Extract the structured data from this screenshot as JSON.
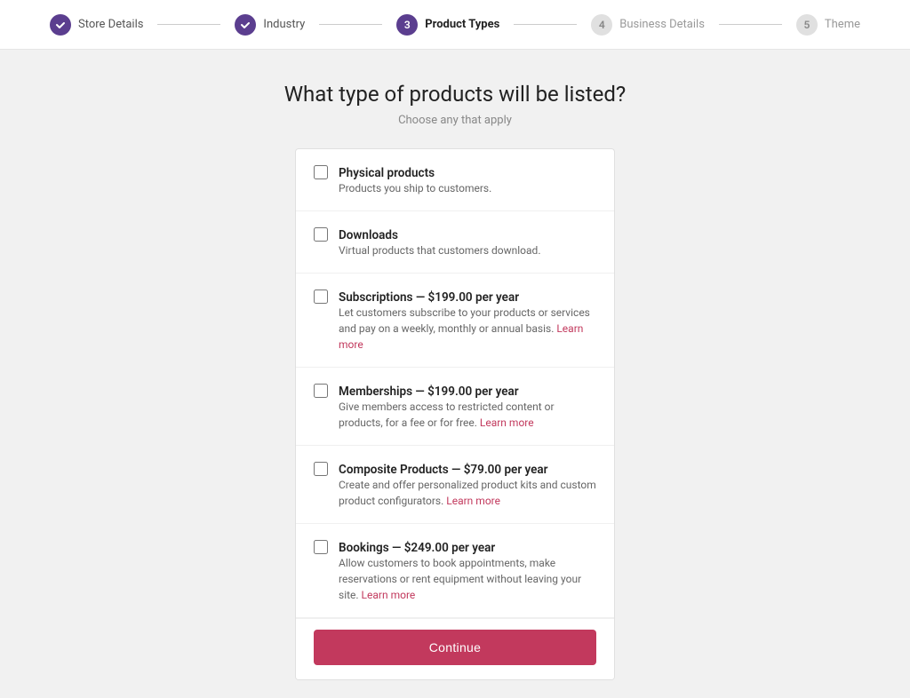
{
  "stepper": {
    "steps": [
      {
        "id": "store-details",
        "number": "✓",
        "label": "Store Details",
        "state": "completed"
      },
      {
        "id": "industry",
        "number": "✓",
        "label": "Industry",
        "state": "completed"
      },
      {
        "id": "product-types",
        "number": "3",
        "label": "Product Types",
        "state": "active"
      },
      {
        "id": "business-details",
        "number": "4",
        "label": "Business Details",
        "state": "inactive"
      },
      {
        "id": "theme",
        "number": "5",
        "label": "Theme",
        "state": "inactive"
      }
    ]
  },
  "page": {
    "heading": "What type of products will be listed?",
    "subheading": "Choose any that apply"
  },
  "options": [
    {
      "id": "physical",
      "title": "Physical products",
      "description": "Products you ship to customers.",
      "has_link": false,
      "link_text": "",
      "link_url": ""
    },
    {
      "id": "downloads",
      "title": "Downloads",
      "description": "Virtual products that customers download.",
      "has_link": false,
      "link_text": "",
      "link_url": ""
    },
    {
      "id": "subscriptions",
      "title": "Subscriptions — $199.00 per year",
      "description": "Let customers subscribe to your products or services and pay on a weekly, monthly or annual basis.",
      "has_link": true,
      "link_text": "Learn more",
      "link_url": "#"
    },
    {
      "id": "memberships",
      "title": "Memberships — $199.00 per year",
      "description": "Give members access to restricted content or products, for a fee or for free.",
      "has_link": true,
      "link_text": "Learn more",
      "link_url": "#"
    },
    {
      "id": "composite",
      "title": "Composite Products — $79.00 per year",
      "description": "Create and offer personalized product kits and custom product configurators.",
      "has_link": true,
      "link_text": "Learn more",
      "link_url": "#"
    },
    {
      "id": "bookings",
      "title": "Bookings — $249.00 per year",
      "description": "Allow customers to book appointments, make reservations or rent equipment without leaving your site.",
      "has_link": true,
      "link_text": "Learn more",
      "link_url": "#"
    }
  ],
  "buttons": {
    "continue": "Continue"
  },
  "colors": {
    "primary_purple": "#5b3e8f",
    "primary_pink": "#c2395d",
    "link": "#c2395d"
  }
}
